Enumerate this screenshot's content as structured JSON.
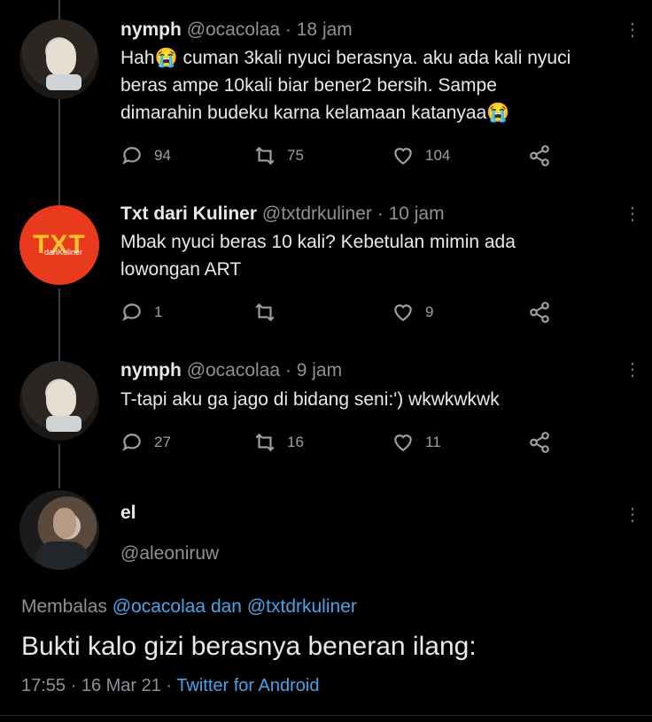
{
  "tweets": [
    {
      "name": "nymph",
      "handle": "@ocacolaa",
      "time": "· 18 jam",
      "lines": [
        "Hah😭 cuman 3kali nyuci berasnya. aku ada kali nyuci",
        "beras ampe 10kali biar bener2 bersih. Sampe",
        "dimarahin budeku karna kelamaan katanyaa😭"
      ],
      "replies": "94",
      "retweets": "75",
      "likes": "104"
    },
    {
      "name": "Txt dari Kuliner",
      "handle": "@txtdrkuliner",
      "time": "· 10 jam",
      "logo": "TXT",
      "logo_sub": "dariKuliner",
      "lines": [
        "Mbak nyuci beras 10 kali? Kebetulan mimin ada",
        "lowongan ART"
      ],
      "replies": "1",
      "retweets": "",
      "likes": "9"
    },
    {
      "name": "nymph",
      "handle": "@ocacolaa",
      "time": "· 9 jam",
      "lines": [
        "T-tapi aku ga jago di bidang seni:') wkwkwkwk"
      ],
      "replies": "27",
      "retweets": "16",
      "likes": "11"
    }
  ],
  "main": {
    "name": "el",
    "handle": "@aleoniruw",
    "reply_prefix": "Membalas",
    "reply_user1": "@ocacolaa",
    "reply_and": "dan",
    "reply_user2": "@txtdrkuliner",
    "text": "Bukti kalo gizi berasnya beneran ilang:",
    "time": "17:55 · 16 Mar 21 ·",
    "source": "Twitter for Android"
  },
  "icons": {
    "more": "more-vertical-icon",
    "reply": "comment-icon",
    "retweet": "retweet-icon",
    "like": "heart-icon",
    "share": "share-icon"
  }
}
